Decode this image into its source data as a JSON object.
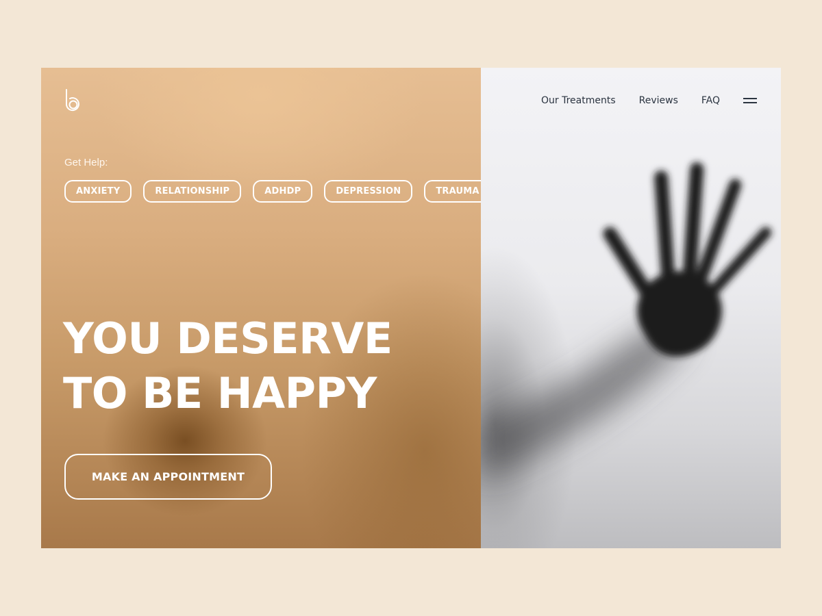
{
  "brand": {
    "logo_icon": "b-letter-logo-icon"
  },
  "nav": {
    "items": [
      {
        "label": "Our Treatments"
      },
      {
        "label": "Reviews"
      },
      {
        "label": "FAQ"
      }
    ],
    "menu_icon": "hamburger-menu-icon"
  },
  "get_help": {
    "label": "Get Help:",
    "chips": [
      {
        "label": "ANXIETY"
      },
      {
        "label": "RELATIONSHIP"
      },
      {
        "label": "ADHDP"
      },
      {
        "label": "DEPRESSION"
      },
      {
        "label": "TRAUMA"
      }
    ]
  },
  "hero": {
    "headline_line1": "YOU DESERVE",
    "headline_line2": "TO BE HAPPY",
    "cta_label": "MAKE AN APPOINTMENT",
    "image_subject": "hand-silhouette-behind-frosted-glass"
  },
  "colors": {
    "page_background": "#f3e7d6",
    "left_panel": "#d9ad7f",
    "right_panel": "#ebebee",
    "nav_text": "#2b3440",
    "hero_text": "#ffffff"
  }
}
